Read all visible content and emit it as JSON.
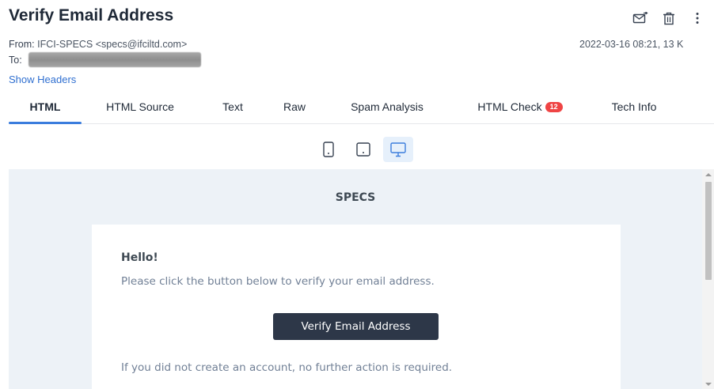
{
  "message": {
    "subject": "Verify Email Address",
    "from_label": "From:",
    "from_value": "IFCI-SPECS <specs@ifciltd.com>",
    "to_label": "To:",
    "date_size": "2022-03-16 08:21, 13 K",
    "show_headers": "Show Headers"
  },
  "actions": [
    {
      "name": "forward-icon"
    },
    {
      "name": "trash-icon"
    },
    {
      "name": "more-options-icon"
    }
  ],
  "tabs": {
    "html": "HTML",
    "html_source": "HTML Source",
    "text": "Text",
    "raw": "Raw",
    "spam_analysis": "Spam Analysis",
    "html_check": "HTML Check",
    "html_check_badge": "12",
    "tech_info": "Tech Info",
    "active": "HTML"
  },
  "device_view": {
    "options": [
      "mobile",
      "tablet",
      "desktop"
    ],
    "selected": "desktop"
  },
  "email_body": {
    "brand": "SPECS",
    "greeting": "Hello!",
    "paragraph1": "Please click the button below to verify your email address.",
    "button_label": "Verify Email Address",
    "paragraph2": "If you did not create an account, no further action is required."
  },
  "colors": {
    "accent": "#3b7ddd",
    "link": "#2f6fd0",
    "badge": "#ef4444",
    "preview_bg": "#edf2f7",
    "button_bg": "#2d3748"
  }
}
